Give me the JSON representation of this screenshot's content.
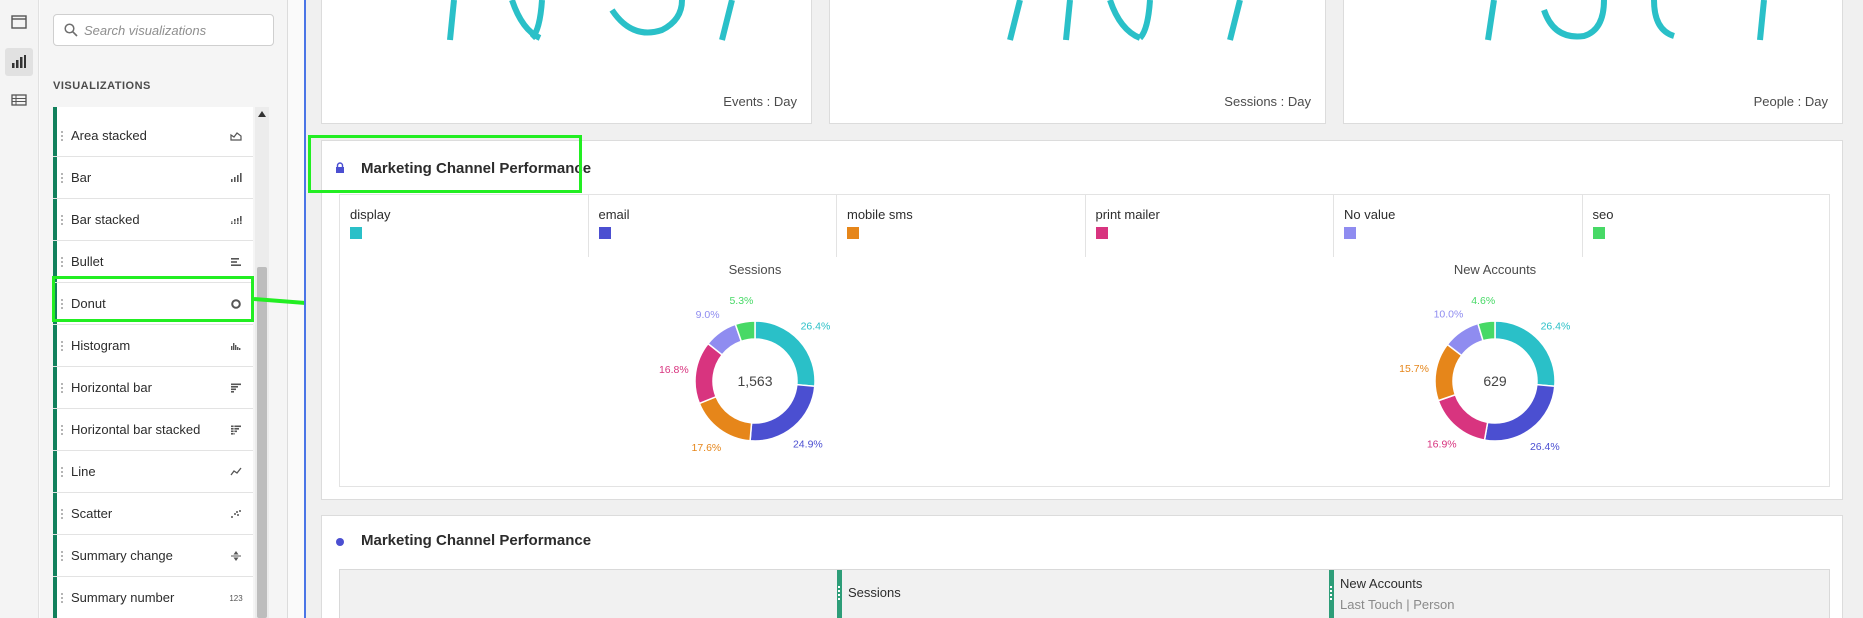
{
  "sidebar": {
    "search_placeholder": "Search visualizations",
    "section_title": "VISUALIZATIONS",
    "items": [
      {
        "label": "Area stacked",
        "icon": "area-stacked-icon"
      },
      {
        "label": "Bar",
        "icon": "bar-icon"
      },
      {
        "label": "Bar stacked",
        "icon": "bar-stacked-icon"
      },
      {
        "label": "Bullet",
        "icon": "bullet-icon"
      },
      {
        "label": "Donut",
        "icon": "donut-icon"
      },
      {
        "label": "Histogram",
        "icon": "histogram-icon"
      },
      {
        "label": "Horizontal bar",
        "icon": "horizontal-bar-icon"
      },
      {
        "label": "Horizontal bar stacked",
        "icon": "horizontal-bar-stacked-icon"
      },
      {
        "label": "Line",
        "icon": "line-icon"
      },
      {
        "label": "Scatter",
        "icon": "scatter-icon"
      },
      {
        "label": "Summary change",
        "icon": "summary-change-icon"
      },
      {
        "label": "Summary number",
        "icon": "summary-number-icon"
      }
    ],
    "summary_number_glyph": "123"
  },
  "kpis": [
    {
      "caption": "Events : Day"
    },
    {
      "caption": "Sessions : Day"
    },
    {
      "caption": "People : Day"
    }
  ],
  "donut_panel": {
    "title": "Marketing Channel Performance",
    "legend": [
      {
        "name": "display",
        "color": "#2ac0c8"
      },
      {
        "name": "email",
        "color": "#4b4fd1"
      },
      {
        "name": "mobile sms",
        "color": "#e6861a"
      },
      {
        "name": "print mailer",
        "color": "#d8347f"
      },
      {
        "name": "No value",
        "color": "#8f8cf0"
      },
      {
        "name": "seo",
        "color": "#47d966"
      }
    ]
  },
  "chart_data": [
    {
      "type": "pie",
      "title": "Sessions",
      "center_label": "1,563",
      "categories": [
        "display",
        "email",
        "mobile sms",
        "print mailer",
        "No value",
        "seo"
      ],
      "values": [
        26.4,
        24.9,
        17.6,
        16.8,
        9.0,
        5.3
      ],
      "labels": [
        "26.4%",
        "24.9%",
        "17.6%",
        "16.8%",
        "9.0%",
        "5.3%"
      ]
    },
    {
      "type": "pie",
      "title": "New Accounts",
      "center_label": "629",
      "categories": [
        "display",
        "email",
        "print mailer",
        "mobile sms",
        "No value",
        "seo"
      ],
      "values": [
        26.4,
        26.4,
        16.9,
        15.7,
        10.0,
        4.6
      ],
      "labels": [
        "26.4%",
        "26.4%",
        "16.9%",
        "15.7%",
        "10.0%",
        "4.6%"
      ]
    }
  ],
  "table_panel": {
    "title": "Marketing Channel Performance",
    "columns": [
      {
        "label": "Sessions",
        "sub": ""
      },
      {
        "label": "New Accounts",
        "sub": "Last Touch | Person"
      }
    ]
  },
  "colors": {
    "accent_green_highlight": "#22ee22",
    "teal": "#2ac0c8",
    "column_green": "#2d9d78"
  }
}
